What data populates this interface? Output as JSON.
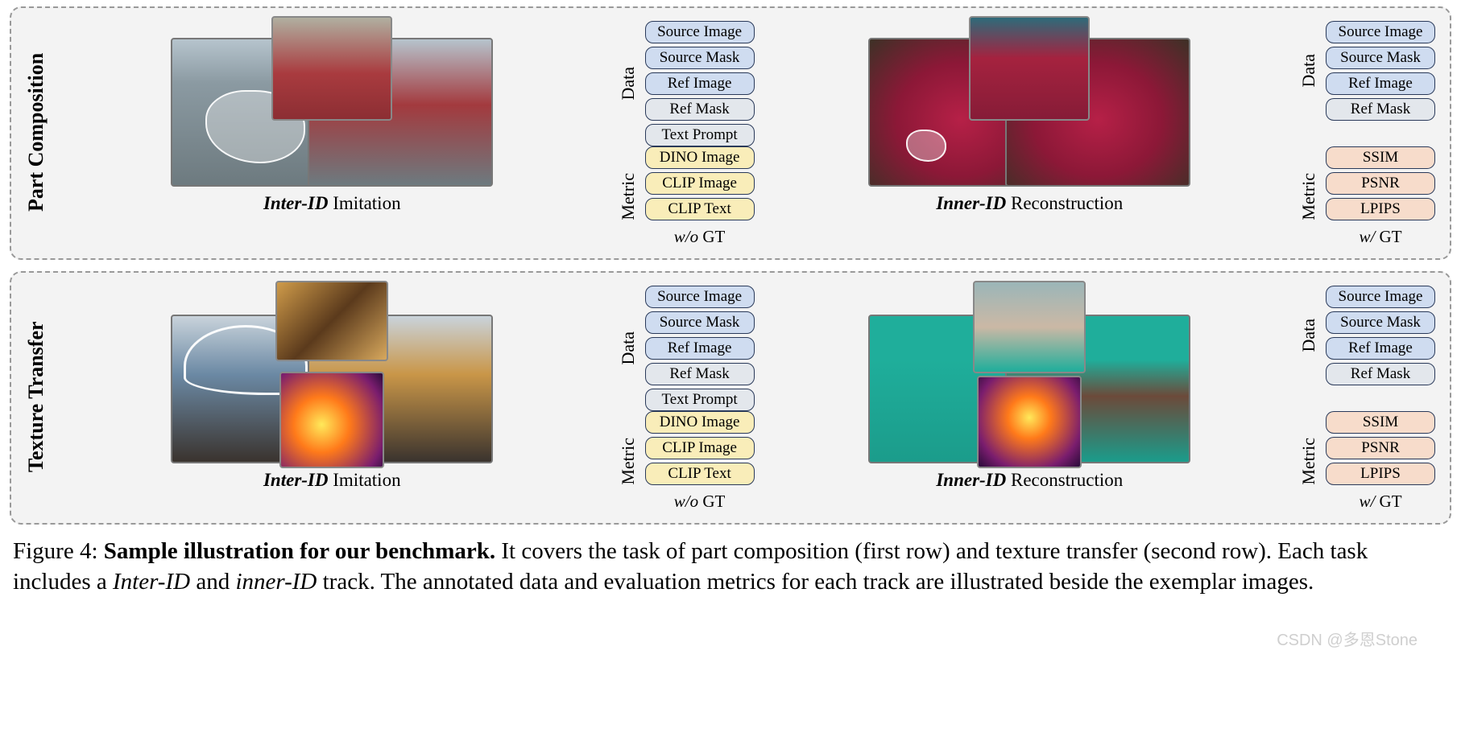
{
  "panels": [
    {
      "row_label": "Part Composition",
      "left": {
        "caption_bold": "Inter-ID",
        "caption_rest": " Imitation",
        "data_label": "Data",
        "metric_label": "Metric",
        "data_pills": [
          "Source Image",
          "Source Mask",
          "Ref Image",
          "Ref Mask",
          "Text Prompt"
        ],
        "data_classes": [
          "pill-blue",
          "pill-blue",
          "pill-blue",
          "pill-grey",
          "pill-grey"
        ],
        "metric_pills": [
          "DINO Image",
          "CLIP Image",
          "CLIP Text"
        ],
        "gt_it": "w/o",
        "gt_rest": " GT"
      },
      "right": {
        "caption_bold": "Inner-ID",
        "caption_rest": " Reconstruction",
        "data_label": "Data",
        "metric_label": "Metric",
        "data_pills": [
          "Source Image",
          "Source Mask",
          "Ref Image",
          "Ref Mask"
        ],
        "data_classes": [
          "pill-blue",
          "pill-blue",
          "pill-blue",
          "pill-grey"
        ],
        "metric_pills": [
          "SSIM",
          "PSNR",
          "LPIPS"
        ],
        "gt_it": "w/",
        "gt_rest": " GT"
      }
    },
    {
      "row_label": "Texture Transfer",
      "left": {
        "caption_bold": "Inter-ID",
        "caption_rest": " Imitation",
        "data_label": "Data",
        "metric_label": "Metric",
        "data_pills": [
          "Source Image",
          "Source Mask",
          "Ref Image",
          "Ref Mask",
          "Text Prompt"
        ],
        "data_classes": [
          "pill-blue",
          "pill-blue",
          "pill-blue",
          "pill-grey",
          "pill-grey"
        ],
        "metric_pills": [
          "DINO Image",
          "CLIP Image",
          "CLIP Text"
        ],
        "gt_it": "w/o",
        "gt_rest": " GT"
      },
      "right": {
        "caption_bold": "Inner-ID",
        "caption_rest": " Reconstruction",
        "data_label": "Data",
        "metric_label": "Metric",
        "data_pills": [
          "Source Image",
          "Source Mask",
          "Ref Image",
          "Ref Mask"
        ],
        "data_classes": [
          "pill-blue",
          "pill-blue",
          "pill-blue",
          "pill-grey"
        ],
        "metric_pills": [
          "SSIM",
          "PSNR",
          "LPIPS"
        ],
        "gt_it": "w/",
        "gt_rest": " GT"
      }
    }
  ],
  "caption": {
    "fig_num": "Figure 4: ",
    "bold": "Sample illustration for our benchmark.",
    "t1": " It covers the task of part composition (first row) and texture transfer (second row). Each task includes a ",
    "i1": "Inter-ID",
    "t2": " and ",
    "i2": "inner-ID",
    "t3": " track. The annotated data and evaluation metrics for each track are illustrated beside the exemplar images."
  },
  "watermark": "CSDN @多恩Stone"
}
